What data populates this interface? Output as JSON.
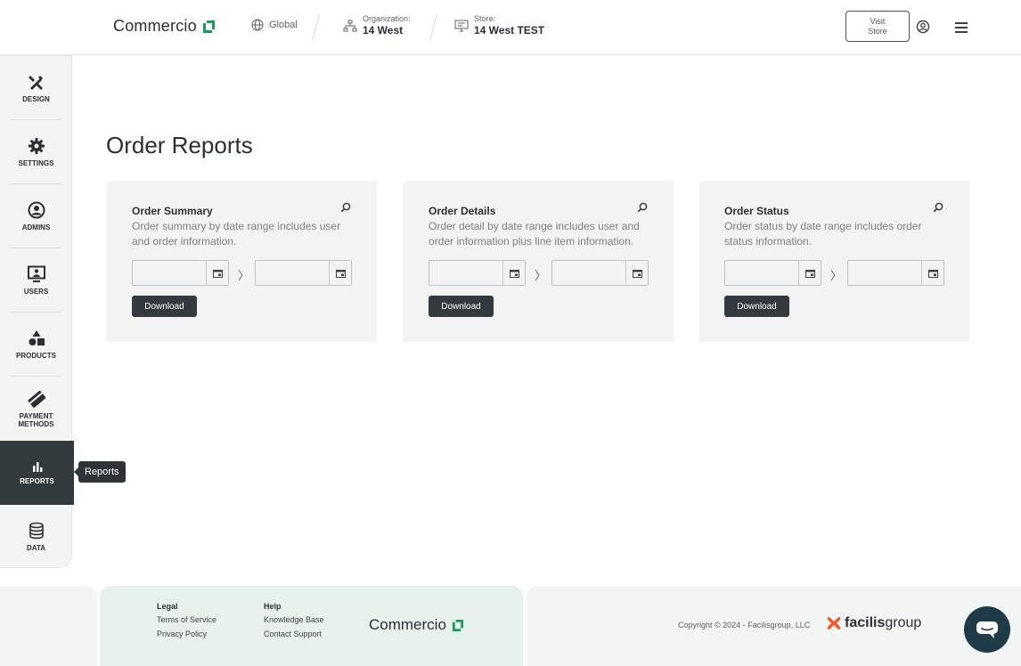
{
  "header": {
    "brand": "Commercio",
    "global_label": "Global",
    "org_label": "Organization:",
    "org_value": "14 West",
    "store_label": "Store:",
    "store_value": "14 West TEST",
    "visit_line1": "Visit",
    "visit_line2": "Store"
  },
  "sidebar": {
    "items": [
      {
        "label": "DESIGN",
        "icon": "design-icon"
      },
      {
        "label": "SETTINGS",
        "icon": "gear-icon"
      },
      {
        "label": "ADMINS",
        "icon": "user-circle-icon"
      },
      {
        "label": "USERS",
        "icon": "monitor-user-icon"
      },
      {
        "label": "PRODUCTS",
        "icon": "shapes-icon"
      },
      {
        "label": "PAYMENT",
        "label2": "METHODS",
        "icon": "card-icon"
      },
      {
        "label": "REPORTS",
        "icon": "bar-chart-icon"
      },
      {
        "label": "DATA",
        "icon": "database-icon"
      }
    ],
    "active_index": 6,
    "tooltip": "Reports"
  },
  "main": {
    "title": "Order Reports",
    "cards": [
      {
        "title": "Order Summary",
        "description": "Order summary by date range includes user and order information.",
        "download": "Download"
      },
      {
        "title": "Order Details",
        "description": "Order detail by date range includes user and order information plus line item information.",
        "download": "Download"
      },
      {
        "title": "Order Status",
        "description": "Order status by date range includes order status information.",
        "download": "Download"
      }
    ],
    "range_arrow": "〉"
  },
  "footer": {
    "legal_heading": "Legal",
    "legal_links": [
      "Terms of Service",
      "Privacy Policy"
    ],
    "help_heading": "Help",
    "help_links": [
      "Knowledge Base",
      "Contact Support"
    ],
    "brand": "Commercio",
    "copyright": "Copyright © 2024 - Facilisgroup, LLC",
    "partner_bold": "facilis",
    "partner_rest": "group"
  },
  "colors": {
    "accent_green": "#1a9a5c",
    "dark": "#323a3e",
    "partner_orange": "#f0592a",
    "chat_bg": "#1f3b47"
  }
}
